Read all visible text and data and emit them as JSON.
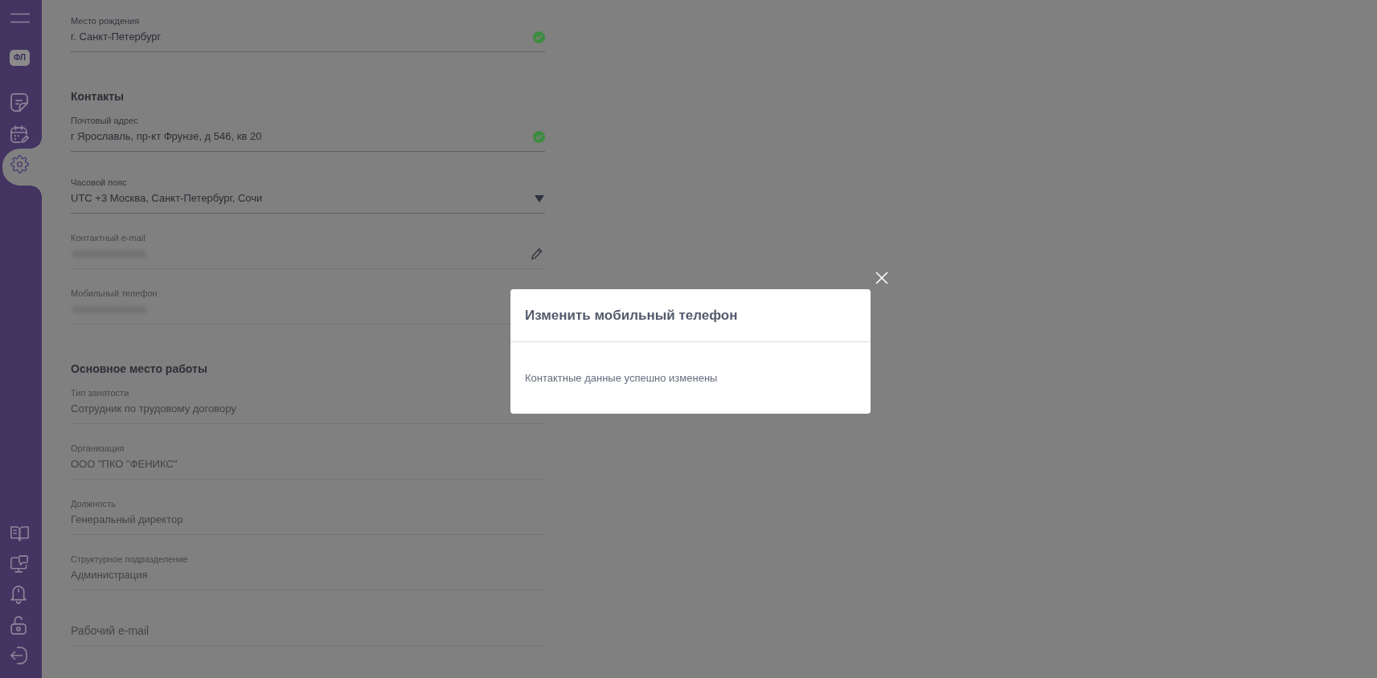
{
  "sidebar": {
    "profile_badge": "ФЛ",
    "top_items": [
      {
        "kind": "document",
        "selected": false
      },
      {
        "kind": "calendar",
        "selected": false
      },
      {
        "kind": "settings",
        "selected": true
      }
    ],
    "bottom_items": [
      {
        "kind": "book",
        "selected": false
      },
      {
        "kind": "support",
        "selected": false
      },
      {
        "kind": "notifications",
        "selected": false
      },
      {
        "kind": "security",
        "selected": false
      },
      {
        "kind": "logout",
        "selected": false
      }
    ]
  },
  "sections": [
    {
      "fields": [
        {
          "label": "Место рождения",
          "value": "г. Санкт-Петербург",
          "kind": "verified",
          "disabled": false
        }
      ]
    },
    {
      "title": "Контакты",
      "fields": [
        {
          "label": "Почтовый адрес",
          "value": "г Ярославль, пр-кт Фрунзе, д 546, кв 20",
          "kind": "verified",
          "disabled": false
        },
        {
          "label": "Часовой пояс",
          "value": "UTC +3 Москва, Санкт-Петербург, Сочи",
          "kind": "select",
          "disabled": false
        },
        {
          "label": "Контактный e-mail",
          "masked": true,
          "kind": "editable",
          "disabled": true
        },
        {
          "label": "Мобильный телефон",
          "masked": true,
          "kind": "plain",
          "disabled": true
        }
      ]
    },
    {
      "title": "Основное место работы",
      "fields": [
        {
          "label": "Тип занятости",
          "value": "Сотрудник по трудовому договору",
          "kind": "plain",
          "disabled": true
        },
        {
          "label": "Организация",
          "value": "ООО \"ПКО \"ФЕНИКС\"",
          "kind": "plain",
          "disabled": true
        },
        {
          "label": "Должность",
          "value": "Генеральный директор",
          "kind": "plain",
          "disabled": true
        },
        {
          "label": "Структурное подразделение",
          "value": "Администрация",
          "kind": "plain",
          "disabled": true
        },
        {
          "placeholder": "Рабочий e-mail",
          "kind": "plain",
          "disabled": true
        }
      ]
    }
  ],
  "dialog": {
    "title": "Изменить мобильный телефон",
    "message": "Контактные данные успешно изменены"
  }
}
